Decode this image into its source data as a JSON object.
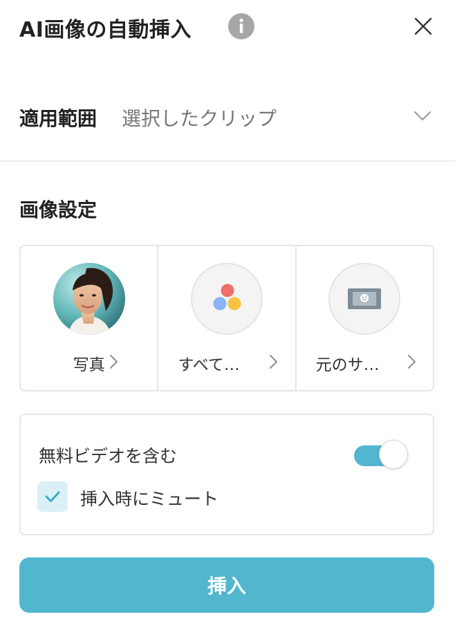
{
  "header": {
    "title": "AI画像の自動挿入",
    "info_icon": "info-icon",
    "close_icon": "close-icon"
  },
  "scope": {
    "label": "適用範囲",
    "value": "選択したクリップ",
    "icon": "chevron-down-icon"
  },
  "image_settings": {
    "title": "画像設定",
    "options": [
      {
        "label": "写真",
        "icon": "portrait-photo-thumbnail"
      },
      {
        "label": "すべて…",
        "icon": "three-colored-dots-icon"
      },
      {
        "label": "元のサ…",
        "icon": "image-frame-icon"
      }
    ]
  },
  "video": {
    "include_free_label": "無料ビデオを含む",
    "include_free_on": true,
    "mute_label": "挿入時にミュート",
    "mute_checked": true
  },
  "actions": {
    "insert_label": "挿入"
  },
  "colors": {
    "accent": "#52b6cf",
    "checkbox_bg": "#daf0f6",
    "info_icon_bg": "#a6a6a6",
    "dot_red": "#ef6f6a",
    "dot_blue": "#8ab4f3",
    "dot_yellow": "#f6c342"
  }
}
